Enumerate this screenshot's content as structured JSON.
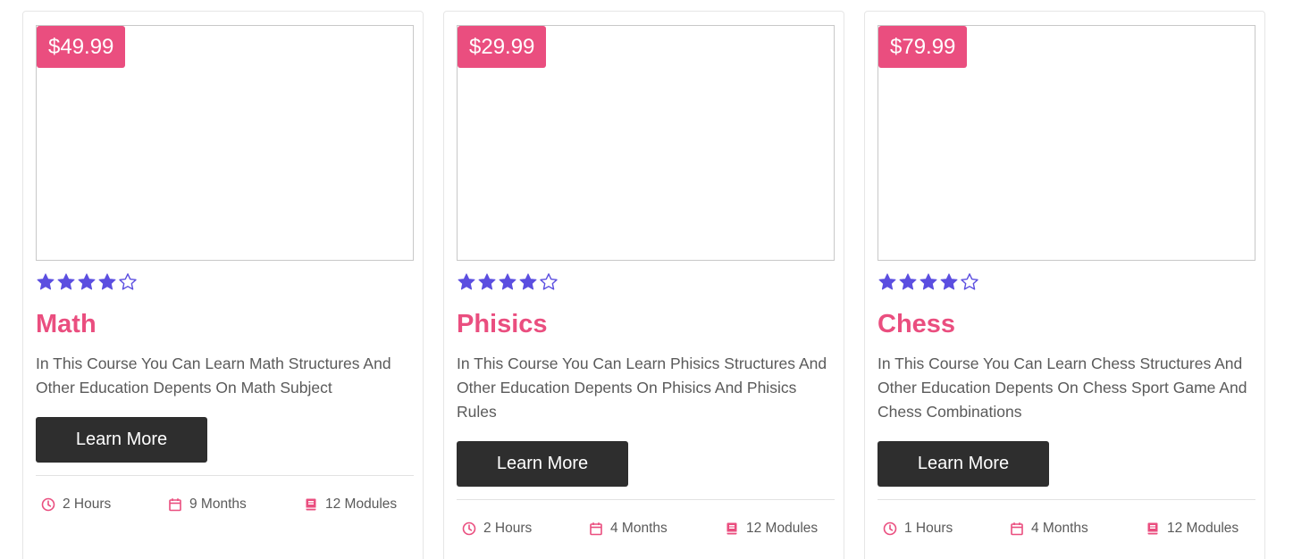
{
  "colors": {
    "accent": "#ea4e7f",
    "star": "#5b4ee0",
    "button": "#2e2e2e",
    "text": "#5a5a5a"
  },
  "cards": [
    {
      "price": "$49.99",
      "rating": 4,
      "rating_max": 5,
      "title": "Math",
      "description": "In This Course You Can Learn Math Structures And Other Education Depents On Math Subject",
      "button_label": "Learn More",
      "hours": "2 Hours",
      "months": "9 Months",
      "modules": "12 Modules"
    },
    {
      "price": "$29.99",
      "rating": 4,
      "rating_max": 5,
      "title": "Phisics",
      "description": "In This Course You Can Learn Phisics Structures And Other Education Depents On Phisics And Phisics Rules",
      "button_label": "Learn More",
      "hours": "2 Hours",
      "months": "4 Months",
      "modules": "12 Modules"
    },
    {
      "price": "$79.99",
      "rating": 4,
      "rating_max": 5,
      "title": "Chess",
      "description": "In This Course You Can Learn Chess Structures And Other Education Depents On Chess Sport Game And Chess Combinations",
      "button_label": "Learn More",
      "hours": "1 Hours",
      "months": "4 Months",
      "modules": "12 Modules"
    }
  ],
  "icons": {
    "hours": "clock-icon",
    "months": "calendar-icon",
    "modules": "book-icon",
    "rating_filled": "star-filled-icon",
    "rating_empty": "star-outline-icon"
  }
}
